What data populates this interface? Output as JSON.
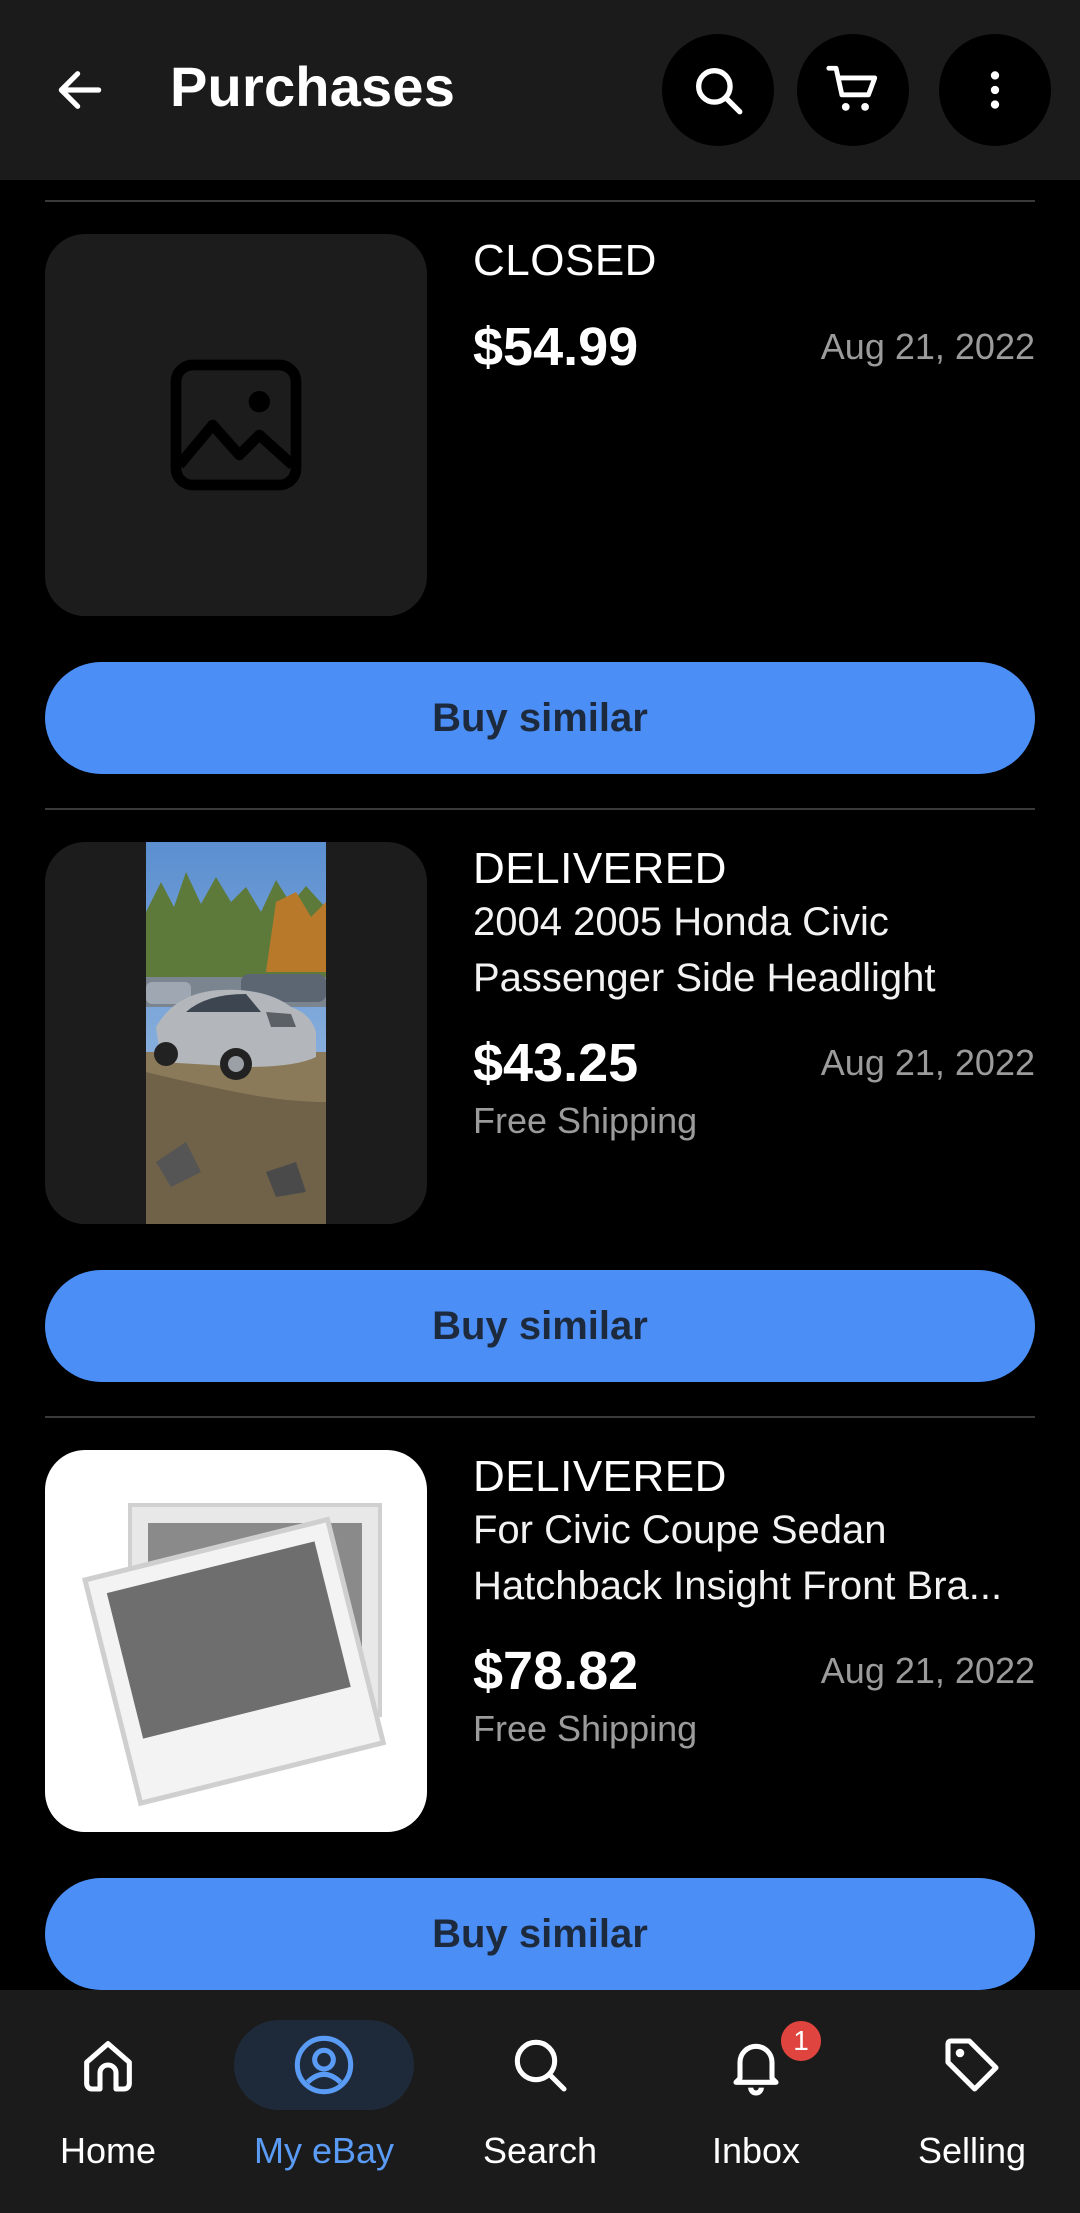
{
  "header": {
    "title": "Purchases",
    "back_icon": "arrow-left-icon",
    "search_icon": "search-icon",
    "cart_icon": "cart-icon",
    "more_icon": "more-vertical-icon"
  },
  "purchases": [
    {
      "status": "CLOSED",
      "title_lines": [],
      "price": "$54.99",
      "date": "Aug 21, 2022",
      "shipping": "",
      "image": "image-placeholder-icon",
      "action": "Buy similar"
    },
    {
      "status": "DELIVERED",
      "title_lines": [
        "2004 2005 Honda Civic",
        "Passenger Side Headlight"
      ],
      "price": "$43.25",
      "date": "Aug 21, 2022",
      "shipping": "Free Shipping",
      "image": "car-photo",
      "action": "Buy similar"
    },
    {
      "status": "DELIVERED",
      "title_lines": [
        "For Civic Coupe Sedan",
        "Hatchback Insight Front Bra..."
      ],
      "price": "$78.82",
      "date": "Aug 21, 2022",
      "shipping": "Free Shipping",
      "image": "photo-stack-placeholder",
      "action": "Buy similar"
    }
  ],
  "bottom_nav": {
    "items": [
      {
        "label": "Home",
        "icon": "home-icon"
      },
      {
        "label": "My eBay",
        "icon": "user-circle-icon",
        "active": true
      },
      {
        "label": "Search",
        "icon": "search-icon"
      },
      {
        "label": "Inbox",
        "icon": "bell-icon",
        "badge": "1"
      },
      {
        "label": "Selling",
        "icon": "tag-icon"
      }
    ]
  },
  "colors": {
    "accent": "#4b8ef5",
    "active_nav": "#5a9bf6",
    "background": "#000000",
    "bar": "#1b1b1b",
    "badge": "#e0443e"
  }
}
